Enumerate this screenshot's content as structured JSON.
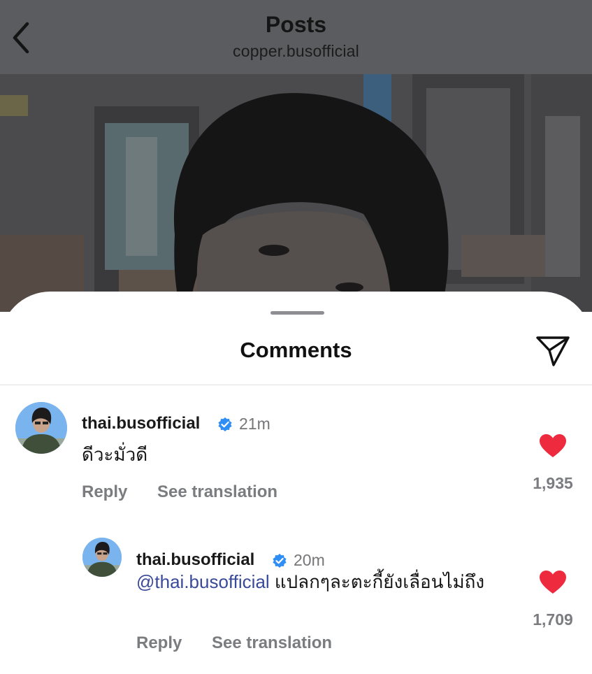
{
  "header": {
    "title": "Posts",
    "subtitle": "copper.busofficial",
    "back_icon": "chevron-left-icon"
  },
  "sheet": {
    "title": "Comments",
    "share_icon": "paper-plane-icon"
  },
  "colors": {
    "heart": "#ee2a3f",
    "verified": "#2f8ef4",
    "mention": "#3a4a9b"
  },
  "comments": [
    {
      "username": "thai.busofficial",
      "verified": true,
      "time": "21m",
      "text": "ดีวะมั่วดี",
      "reply_label": "Reply",
      "translate_label": "See translation",
      "likes": "1,935",
      "liked": true
    },
    {
      "username": "thai.busofficial",
      "verified": true,
      "time": "20m",
      "mention": "@thai.busofficial",
      "text": " แปลกๆละตะกี้ยังเลื่อนไม่ถึง",
      "reply_label": "Reply",
      "translate_label": "See translation",
      "likes": "1,709",
      "liked": true
    }
  ]
}
